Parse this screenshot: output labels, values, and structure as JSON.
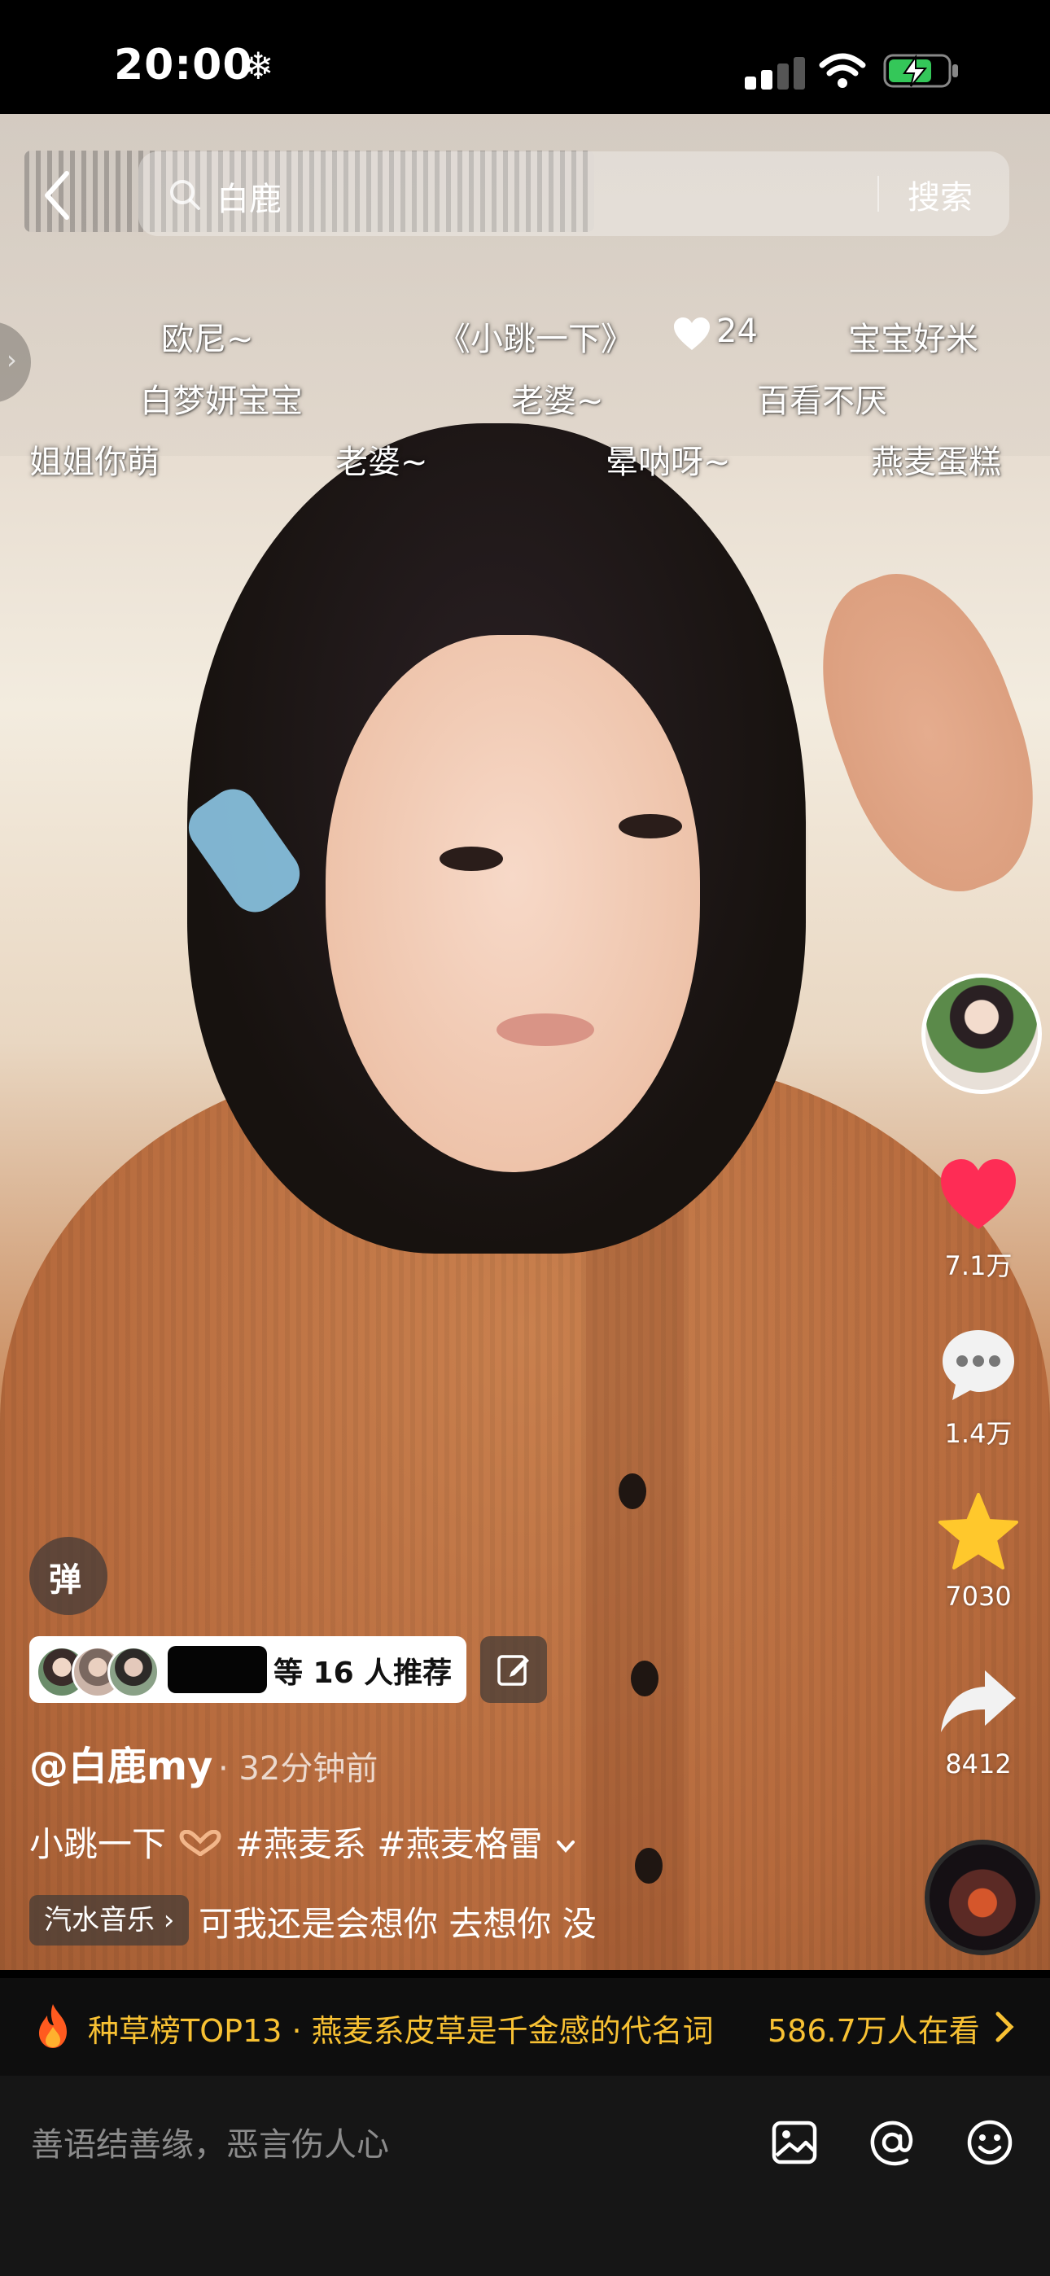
{
  "status_bar": {
    "time": "20:00",
    "weather_icon": "snowflake-icon"
  },
  "search": {
    "query": "白鹿",
    "button_label": "搜索"
  },
  "side_tab_glyph": "›",
  "danmaku": [
    {
      "text": "欧尼~"
    },
    {
      "text": "《小跳一下》"
    },
    {
      "text": "24"
    },
    {
      "text": "宝宝好米"
    },
    {
      "text": "白梦妍宝宝"
    },
    {
      "text": "老婆~"
    },
    {
      "text": "百看不厌"
    },
    {
      "text": "姐姐你萌"
    },
    {
      "text": "老婆~"
    },
    {
      "text": "晕呐呀~"
    },
    {
      "text": "燕麦蛋糕"
    }
  ],
  "actions": {
    "like_count": "7.1万",
    "comment_count": "1.4万",
    "favorite_count": "7030",
    "share_count": "8412"
  },
  "danmaku_toggle_label": "弹",
  "recommend": {
    "text": "等 16 人推荐"
  },
  "post": {
    "username": "@白鹿my",
    "time": "· 32分钟前",
    "caption_prefix": "小跳一下",
    "caption_tags": "#燕麦系  #燕麦格雷",
    "music_tag": "汽水音乐 ›",
    "music_name": "可我还是会想你 去想你 没"
  },
  "hot_banner": {
    "title": "种草榜TOP13 · 燕麦系皮草是千金感的代名词",
    "viewers": "586.7万人在看"
  },
  "comment_bar": {
    "placeholder": "善语结善缘，恶言伤人心"
  },
  "colors": {
    "accent_yellow": "#f8c133",
    "like_red": "#fe2c55",
    "favorite_yellow": "#ffc82c"
  }
}
